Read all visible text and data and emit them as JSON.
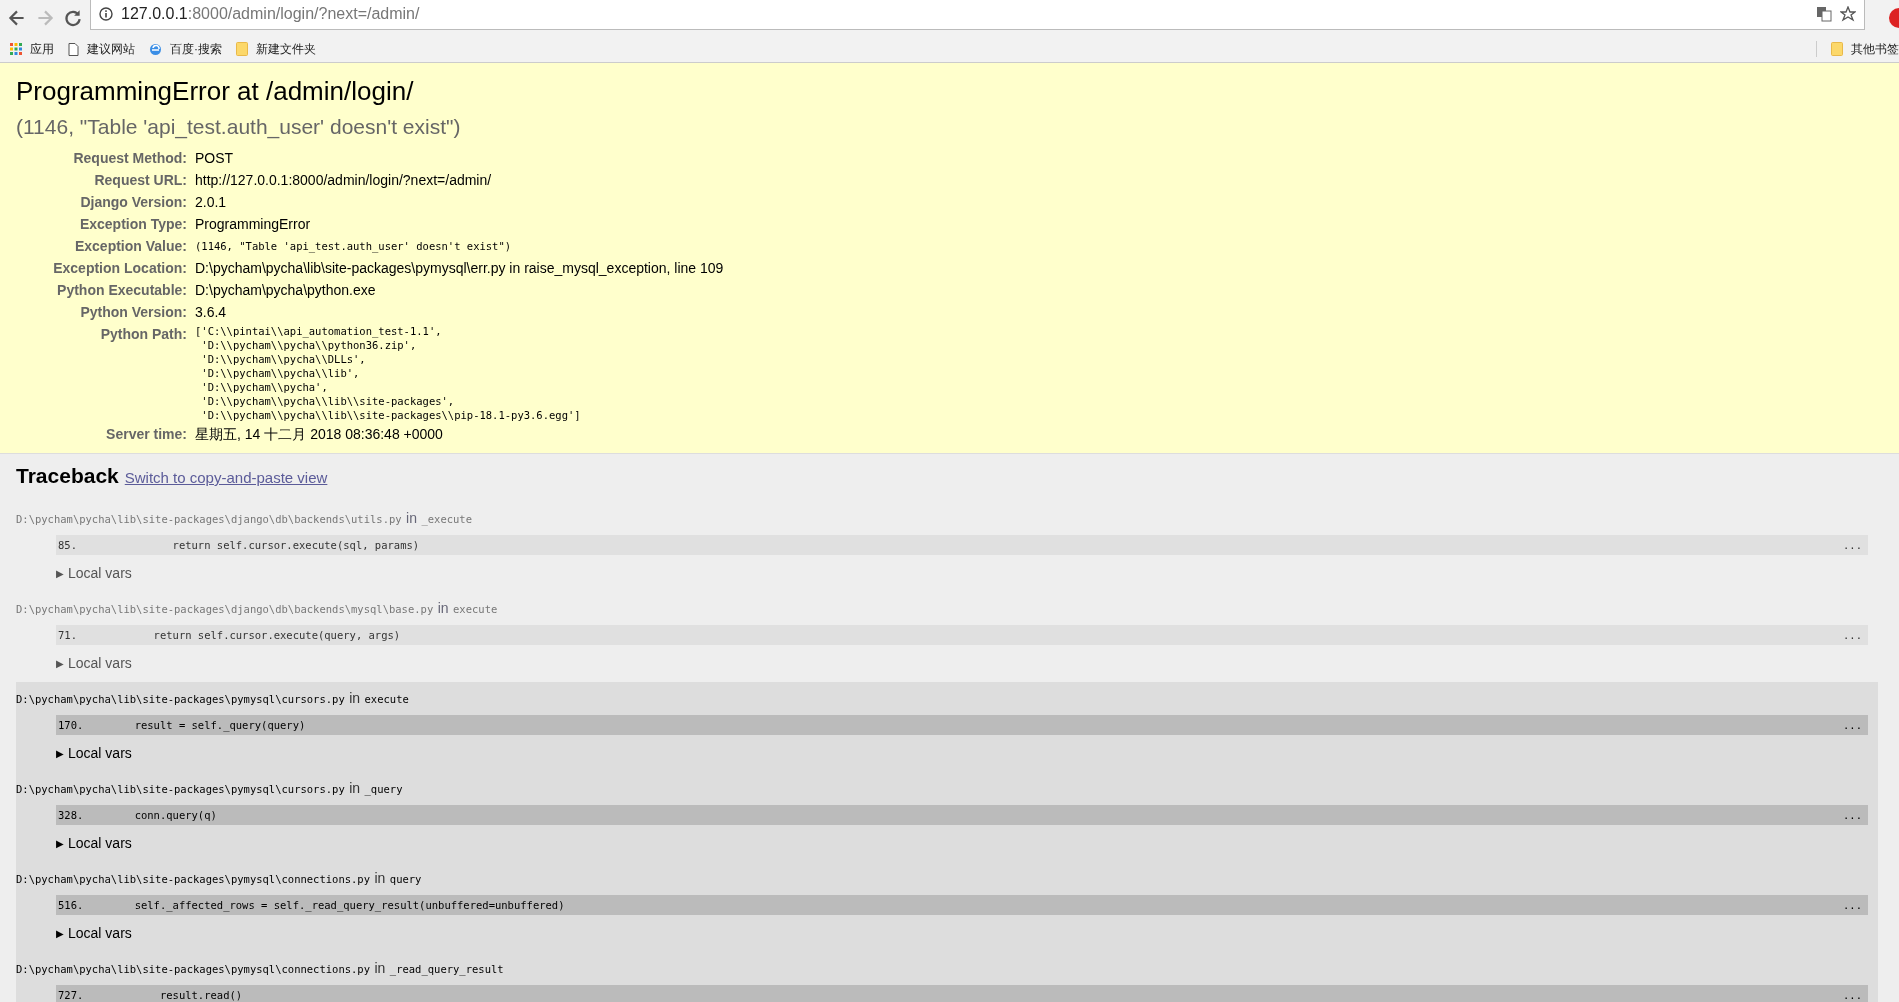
{
  "browser": {
    "url_host": "127.0.0.1",
    "url_path": ":8000/admin/login/?next=/admin/",
    "bookmarks": [
      {
        "label": "应用",
        "kind": "apps"
      },
      {
        "label": "建议网站",
        "kind": "page"
      },
      {
        "label": "百度·搜索",
        "kind": "ie"
      },
      {
        "label": "新建文件夹",
        "kind": "folder"
      }
    ],
    "other_bookmarks": "其他书签"
  },
  "summary": {
    "title": "ProgrammingError at /admin/login/",
    "message": "(1146, \"Table 'api_test.auth_user' doesn't exist\")",
    "meta": [
      {
        "label": "Request Method:",
        "kind": "text",
        "value": "POST"
      },
      {
        "label": "Request URL:",
        "kind": "text",
        "value": "http://127.0.0.1:8000/admin/login/?next=/admin/"
      },
      {
        "label": "Django Version:",
        "kind": "text",
        "value": "2.0.1"
      },
      {
        "label": "Exception Type:",
        "kind": "text",
        "value": "ProgrammingError"
      },
      {
        "label": "Exception Value:",
        "kind": "mono",
        "value": "(1146, \"Table 'api_test.auth_user' doesn't exist\")"
      },
      {
        "label": "Exception Location:",
        "kind": "text",
        "value": "D:\\pycham\\pycha\\lib\\site-packages\\pymysql\\err.py in raise_mysql_exception, line 109"
      },
      {
        "label": "Python Executable:",
        "kind": "text",
        "value": "D:\\pycham\\pycha\\python.exe"
      },
      {
        "label": "Python Version:",
        "kind": "text",
        "value": "3.6.4"
      },
      {
        "label": "Python Path:",
        "kind": "lines",
        "lines": [
          "['C:\\\\pintai\\\\api_automation_test-1.1',",
          " 'D:\\\\pycham\\\\pycha\\\\python36.zip',",
          " 'D:\\\\pycham\\\\pycha\\\\DLLs',",
          " 'D:\\\\pycham\\\\pycha\\\\lib',",
          " 'D:\\\\pycham\\\\pycha',",
          " 'D:\\\\pycham\\\\pycha\\\\lib\\\\site-packages',",
          " 'D:\\\\pycham\\\\pycha\\\\lib\\\\site-packages\\\\pip-18.1-py3.6.egg']"
        ]
      },
      {
        "label": "Server time:",
        "kind": "text",
        "value": "星期五, 14 十二月 2018 08:36:48 +0000"
      }
    ]
  },
  "traceback": {
    "title": "Traceback",
    "link": "Switch to copy-and-paste view",
    "frames": [
      {
        "kind": "django",
        "file": "D:\\pycham\\pycha\\lib\\site-packages\\django\\db\\backends\\utils.py",
        "in_word": "in",
        "function": "_execute",
        "line_number": "85.",
        "code": "        return self.cursor.execute(sql, params)",
        "more": "...",
        "toggle": "▶",
        "local_vars": "Local vars"
      },
      {
        "kind": "django",
        "file": "D:\\pycham\\pycha\\lib\\site-packages\\django\\db\\backends\\mysql\\base.py",
        "in_word": "in",
        "function": "execute",
        "line_number": "71.",
        "code": "     return self.cursor.execute(query, args)",
        "more": "...",
        "toggle": "▶",
        "local_vars": "Local vars"
      },
      {
        "kind": "user",
        "file": "D:\\pycham\\pycha\\lib\\site-packages\\pymysql\\cursors.py",
        "in_word": "in",
        "function": "execute",
        "line_number": "170.",
        "code": "  result = self._query(query)",
        "more": "...",
        "toggle": "▶",
        "local_vars": "Local vars"
      },
      {
        "kind": "user",
        "file": "D:\\pycham\\pycha\\lib\\site-packages\\pymysql\\cursors.py",
        "in_word": "in",
        "function": "_query",
        "line_number": "328.",
        "code": "  conn.query(q)",
        "more": "...",
        "toggle": "▶",
        "local_vars": "Local vars"
      },
      {
        "kind": "user",
        "file": "D:\\pycham\\pycha\\lib\\site-packages\\pymysql\\connections.py",
        "in_word": "in",
        "function": "query",
        "line_number": "516.",
        "code": "  self._affected_rows = self._read_query_result(unbuffered=unbuffered)",
        "more": "...",
        "toggle": "▶",
        "local_vars": "Local vars"
      },
      {
        "kind": "user",
        "file": "D:\\pycham\\pycha\\lib\\site-packages\\pymysql\\connections.py",
        "in_word": "in",
        "function": "_read_query_result",
        "line_number": "727.",
        "code": "      result.read()",
        "more": "..."
      }
    ]
  }
}
